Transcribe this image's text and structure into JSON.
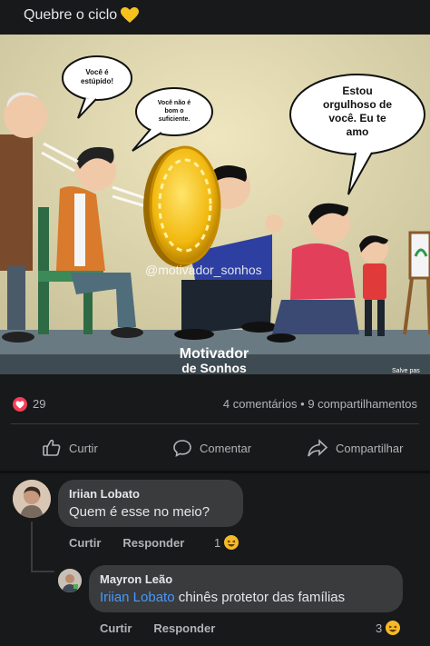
{
  "post": {
    "caption": "Quebre o ciclo",
    "caption_emoji": "yellow-heart-icon",
    "image": {
      "bubbles": [
        "Você é estúpido!",
        "Você não é bom o suficiente.",
        "Estou orgulhoso de você. Eu te amo"
      ],
      "watermark": "@motivador_sonhos",
      "logo_line1": "Motivador",
      "logo_line2": "de Sonhos",
      "corner_text": "Salve pas"
    },
    "reaction_count": "29",
    "share_stats": "4 comentários • 9 compartilhamentos"
  },
  "actions": {
    "like": "Curtir",
    "comment": "Comentar",
    "share": "Compartilhar"
  },
  "comments": [
    {
      "author": "Iriian Lobato",
      "text": "Quem é esse no meio?",
      "like_label": "Curtir",
      "reply_label": "Responder",
      "reaction_count": "1"
    },
    {
      "author": "Mayron Leão",
      "mention": "Iriian Lobato",
      "text": " chinês protetor das famílias",
      "like_label": "Curtir",
      "reply_label": "Responder",
      "reaction_count": "3"
    }
  ],
  "colors": {
    "background": "#18191a",
    "bubble": "#3a3b3c",
    "mention": "#4599ff",
    "love": "#f33e58",
    "secondary_text": "#b0b3b8"
  }
}
